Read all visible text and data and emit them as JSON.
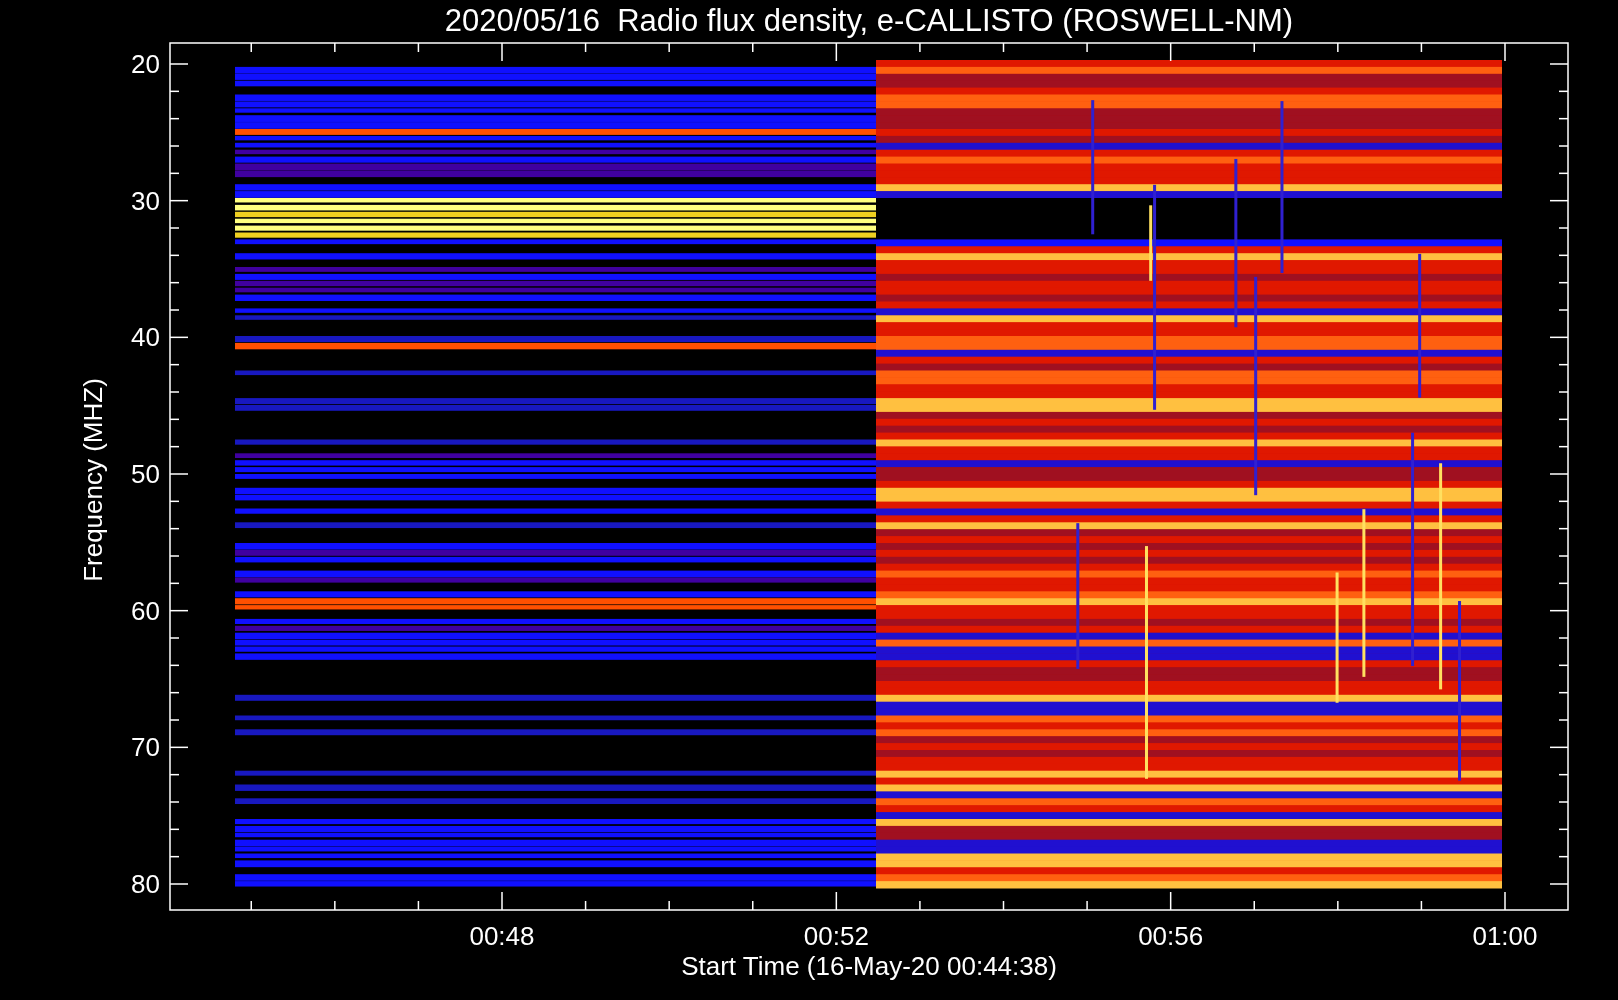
{
  "title": "2020/05/16  Radio flux density, e-CALLISTO (ROSWELL-NM)",
  "ylabel": "Frequency (MHZ)",
  "xlabel": "Start Time (16-May-20 00:44:38)",
  "yticks": [
    "20",
    "30",
    "40",
    "50",
    "60",
    "70",
    "80"
  ],
  "xticks": [
    "00:48",
    "00:52",
    "00:56",
    "01:00"
  ]
}
